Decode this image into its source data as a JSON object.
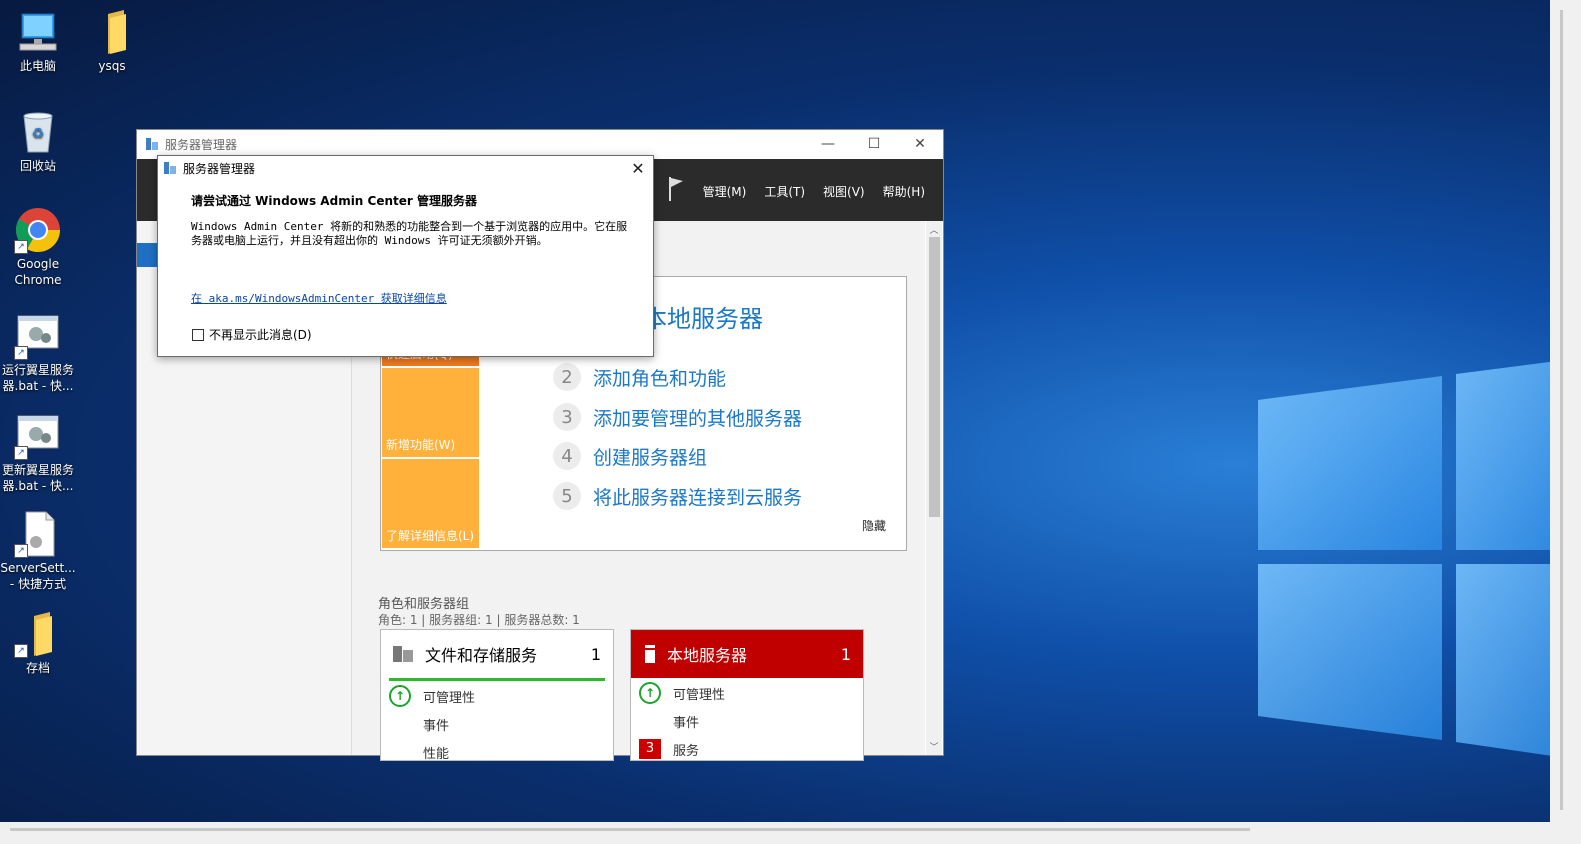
{
  "desktop": {
    "icons": [
      {
        "label": "此电脑",
        "icon": "computer-icon"
      },
      {
        "label": "ysqs",
        "icon": "folder-icon"
      },
      {
        "label": "回收站",
        "icon": "recycle-bin-icon"
      },
      {
        "label": "Google Chrome",
        "icon": "chrome-icon"
      },
      {
        "label": "运行翼星服务器.bat - 快...",
        "icon": "batch-shortcut-icon"
      },
      {
        "label": "更新翼星服务器.bat - 快...",
        "icon": "batch-shortcut-icon"
      },
      {
        "label": "ServerSett... - 快捷方式",
        "icon": "file-shortcut-icon"
      },
      {
        "label": "存档",
        "icon": "folder-icon"
      }
    ]
  },
  "server_manager": {
    "title": "服务器管理器",
    "window_controls": {
      "minimize": "—",
      "maximize": "☐",
      "close": "✕"
    },
    "menu": [
      "管理(M)",
      "工具(T)",
      "视图(V)",
      "帮助(H)"
    ],
    "quick_start": {
      "tiles": [
        "快速启动(Q)",
        "新增功能(W)",
        "了解详细信息(L)"
      ],
      "heading": "本地服务器",
      "steps": [
        {
          "num": "2",
          "label": "添加角色和功能"
        },
        {
          "num": "3",
          "label": "添加要管理的其他服务器"
        },
        {
          "num": "4",
          "label": "创建服务器组"
        },
        {
          "num": "5",
          "label": "将此服务器连接到云服务"
        }
      ],
      "hide": "隐藏"
    },
    "roles": {
      "title": "角色和服务器组",
      "subtitle": "角色: 1 | 服务器组: 1 | 服务器总数: 1",
      "cards": [
        {
          "name": "文件和存储服务",
          "count": "1",
          "rows": [
            "可管理性",
            "事件",
            "性能"
          ]
        },
        {
          "name": "本地服务器",
          "count": "1",
          "rows": [
            "可管理性",
            "事件",
            "服务"
          ],
          "badge": "3"
        }
      ]
    }
  },
  "dialog": {
    "title": "服务器管理器",
    "close": "✕",
    "heading": "请尝试通过 Windows Admin Center 管理服务器",
    "body": "Windows Admin Center 将新的和熟悉的功能整合到一个基于浏览器的应用中。它在服务器或电脑上运行，并且没有超出你的 Windows 许可证无须额外开销。",
    "link": "在 aka.ms/WindowsAdminCenter 获取详细信息",
    "checkbox_label": "不再显示此消息(D)"
  },
  "colors": {
    "accent_blue": "#1b78c8",
    "orange": "#ffb13c",
    "orange_dark": "#f07a1e",
    "red": "#c00000",
    "header_dark": "#2b2b2b"
  }
}
